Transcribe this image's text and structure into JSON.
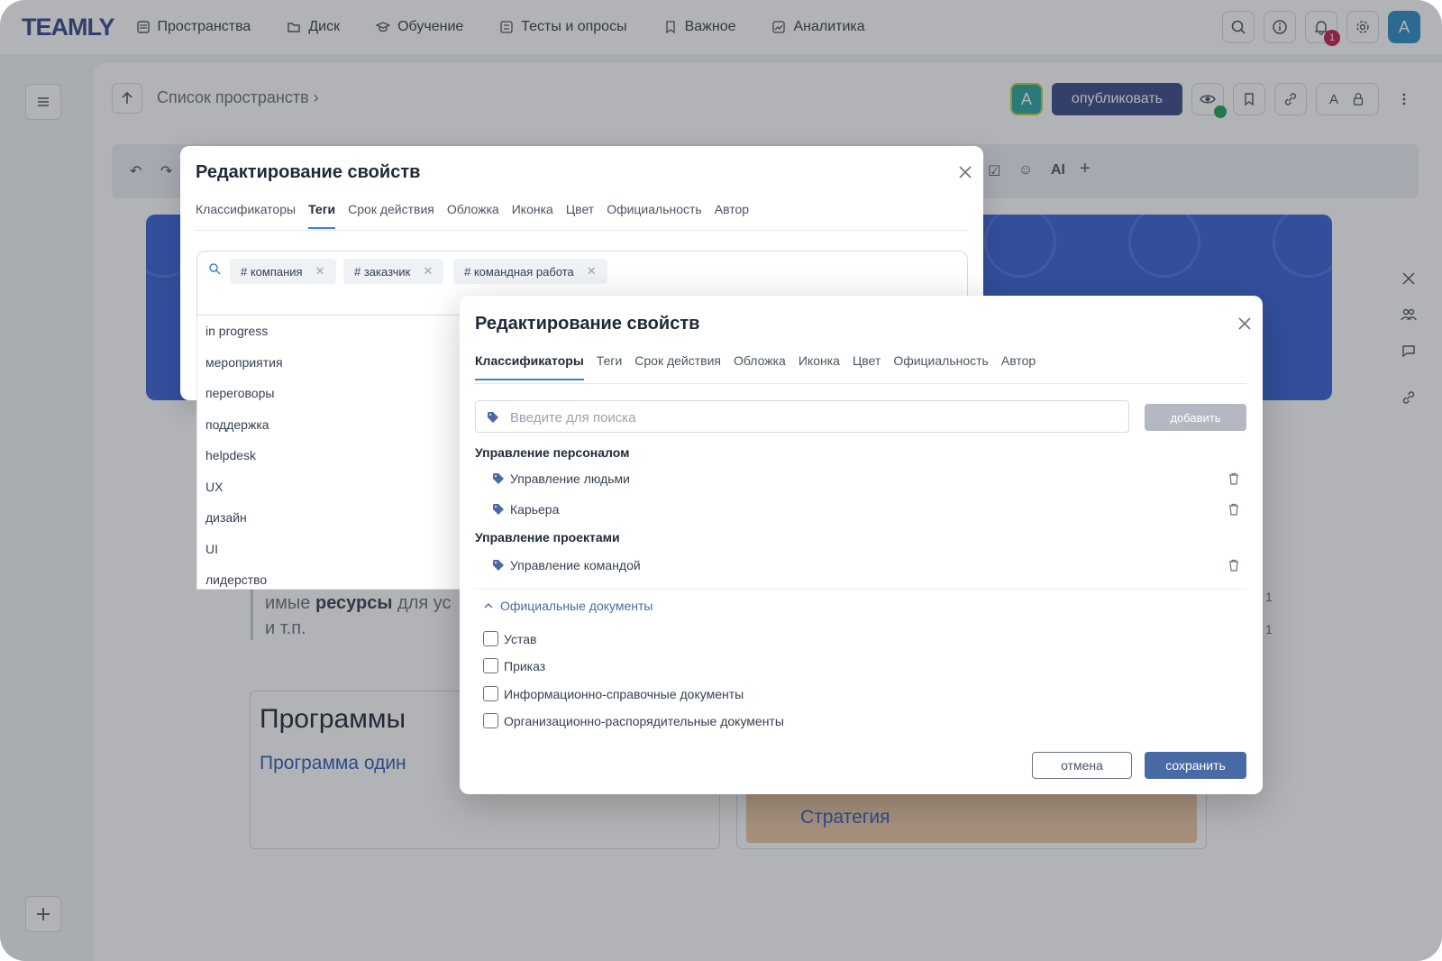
{
  "app": {
    "logo": "TEAMLY",
    "nav": [
      "Пространства",
      "Диск",
      "Обучение",
      "Тесты и опросы",
      "Важное",
      "Аналитика"
    ],
    "notifications_count": "1",
    "user_initial": "A",
    "accent": "#3b4e88"
  },
  "page": {
    "breadcrumb": "Список пространств ›",
    "author_initial": "A",
    "publish_label": "опубликовать",
    "editor_tools": {
      "ai": "AI",
      "plus": "+"
    },
    "font_button": "A",
    "bg_text_rich": "имые ресурсы",
    "bg_text_prefix": "имые ",
    "bg_text_bold": "ресурсы",
    "bg_text_suffix": " для ус",
    "bg_text_line2": "и т.п.",
    "card1_title": "Программы",
    "card1_link": "Программа один",
    "card2_link": "Стратегия",
    "card2_hidden": "Стратегия",
    "page_mark_1": "1",
    "page_mark_2": "1",
    "banner_color": "#3a63d6"
  },
  "modal_back": {
    "title": "Редактирование свойств",
    "tabs": [
      "Классификаторы",
      "Теги",
      "Срок действия",
      "Обложка",
      "Иконка",
      "Цвет",
      "Официальность",
      "Автор"
    ],
    "active_tab": "Теги",
    "chips": [
      "# компания",
      "# заказчик",
      "# командная работа"
    ],
    "tag_options": [
      "in progress",
      "мероприятия",
      "переговоры",
      "поддержка",
      "helpdesk",
      "UX",
      "дизайн",
      "UI",
      "лидерство"
    ]
  },
  "modal_front": {
    "title": "Редактирование свойств",
    "tabs": [
      "Классификаторы",
      "Теги",
      "Срок действия",
      "Обложка",
      "Иконка",
      "Цвет",
      "Официальность",
      "Автор"
    ],
    "active_tab": "Классификаторы",
    "search_placeholder": "Введите для поиска",
    "add_label": "добавить",
    "groups": [
      {
        "title": "Управление персоналом",
        "items": [
          "Управление людьми",
          "Карьера"
        ]
      },
      {
        "title": "Управление проектами",
        "items": [
          "Управление командой"
        ]
      }
    ],
    "folder_label": "Официальные документы",
    "checkboxes": [
      "Устав",
      "Приказ",
      "Информационно-справочные документы",
      "Организационно-распорядительные документы"
    ],
    "cancel_label": "отмена",
    "save_label": "сохранить"
  }
}
